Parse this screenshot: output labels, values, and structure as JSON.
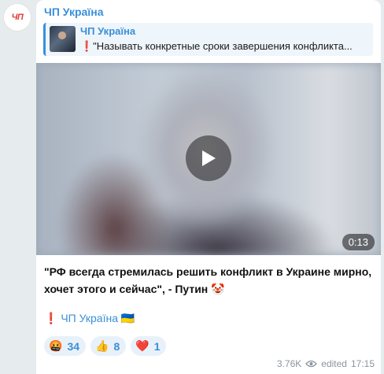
{
  "channel": {
    "avatar_text": "ЧП",
    "name": "ЧП Україна"
  },
  "reply": {
    "title": "ЧП Україна",
    "text": "❗️\"Называть конкретные сроки завершения конфликта..."
  },
  "video": {
    "duration": "0:13",
    "play_icon": "play-icon"
  },
  "caption": "\"РФ всегда стремилась решить конфликт в Украине мирно, хочет этого и сейчас\", - Путин 🤡",
  "signature": "❗️ ЧП Україна 🇺🇦",
  "reactions": [
    {
      "emoji": "🤬",
      "count": "34"
    },
    {
      "emoji": "👍",
      "count": "8"
    },
    {
      "emoji": "❤️",
      "count": "1"
    }
  ],
  "meta": {
    "views": "3.76K",
    "edited_label": "edited",
    "time": "17:15"
  },
  "colors": {
    "accent": "#3a8fd8",
    "background": "#e6ebee"
  }
}
